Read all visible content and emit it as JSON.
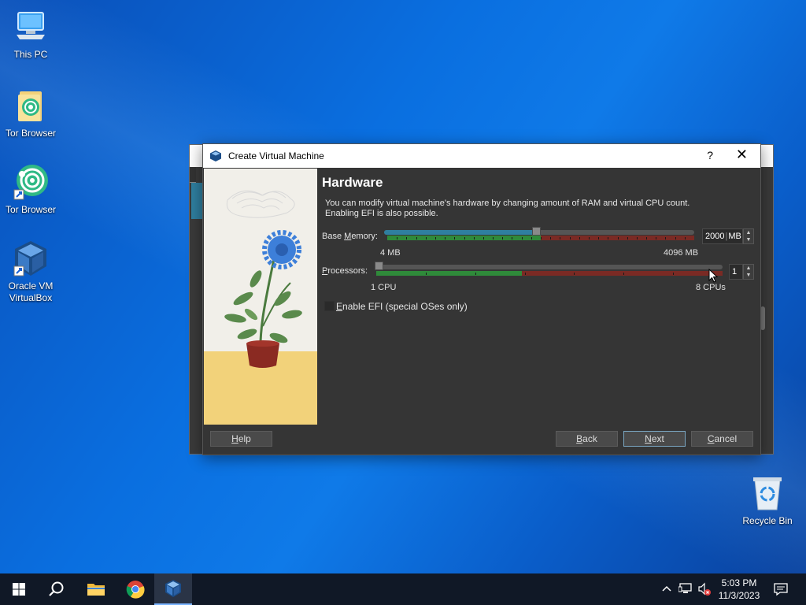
{
  "desktop": {
    "icons": [
      {
        "label": "This PC",
        "icon": "computer-icon"
      },
      {
        "label": "Tor Browser",
        "icon": "tor-folder-icon"
      },
      {
        "label": "Tor Browser",
        "icon": "tor-browser-icon"
      },
      {
        "label": "Oracle VM VirtualBox",
        "label_line1": "Oracle VM",
        "label_line2": "VirtualBox",
        "icon": "virtualbox-icon"
      },
      {
        "label": "Recycle Bin",
        "icon": "recycle-bin-icon"
      }
    ]
  },
  "dialog": {
    "title": "Create Virtual Machine",
    "help_symbol": "?",
    "close_symbol": "✕",
    "heading": "Hardware",
    "description_line1": "You can modify virtual machine's hardware by changing amount of RAM and virtual CPU count.",
    "description_line2": "Enabling EFI is also possible.",
    "base_memory": {
      "label_pre": "Base ",
      "label_u": "M",
      "label_post": "emory:",
      "value": "2000",
      "unit": "MB",
      "min_label": "4 MB",
      "max_label": "4096 MB",
      "min": 4,
      "max": 4096,
      "current": 2000,
      "recommended_fraction": 0.5
    },
    "processors": {
      "label_pre": "",
      "label_u": "P",
      "label_post": "rocessors:",
      "value": "1",
      "min_label": "1 CPU",
      "max_label": "8 CPUs",
      "min": 1,
      "max": 8,
      "current": 1,
      "recommended_fraction": 0.42
    },
    "efi": {
      "label_pre": "",
      "label_u": "E",
      "label_post": "nable EFI (special OSes only)",
      "checked": false
    },
    "buttons": {
      "help_u": "H",
      "help_rest": "elp",
      "back_u": "B",
      "back_rest": "ack",
      "next_u": "N",
      "next_rest": "ext",
      "cancel_u": "C",
      "cancel_rest": "ancel"
    }
  },
  "taskbar": {
    "apps": [
      "start-button",
      "search-button",
      "file-explorer",
      "chrome",
      "virtualbox"
    ],
    "time": "5:03 PM",
    "date": "11/3/2023"
  },
  "colors": {
    "desktop_blue": "#0a6fe0",
    "dialog_bg": "#353535",
    "scale_green": "#2f8a3a",
    "scale_red": "#7a2a24",
    "progress_blue": "#2f7fa0"
  }
}
